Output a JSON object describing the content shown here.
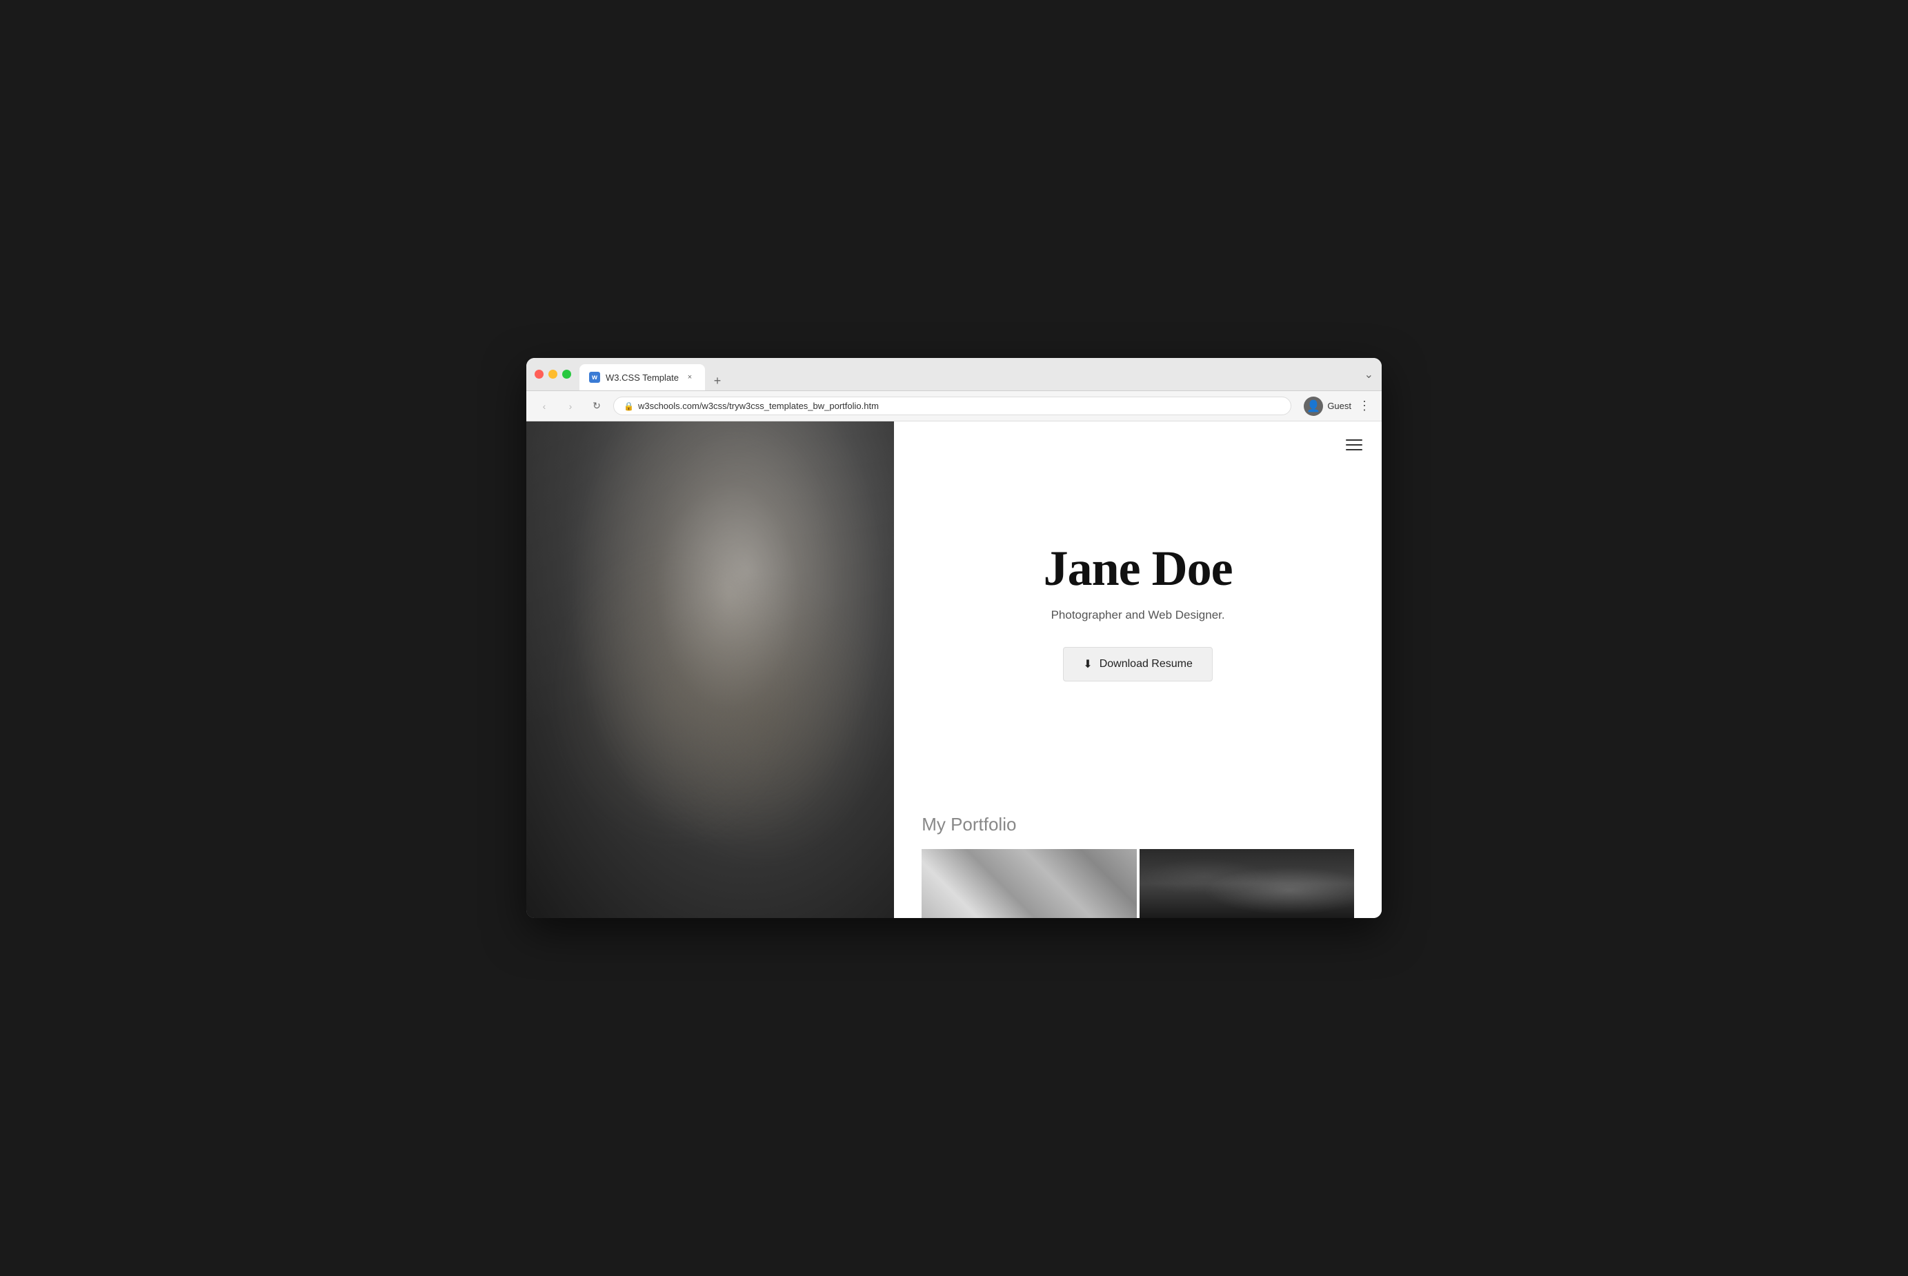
{
  "browser": {
    "tab_favicon": "w",
    "tab_title": "W3.CSS Template",
    "tab_close": "×",
    "tab_new": "+",
    "nav_back": "‹",
    "nav_forward": "›",
    "nav_reload": "↻",
    "address_url": "w3schools.com/w3css/tryw3css_templates_bw_portfolio.htm",
    "profile_icon": "👤",
    "profile_name": "Guest",
    "menu_dots": "⋮",
    "chevron_down": "⌄"
  },
  "page": {
    "hamburger_label": "menu",
    "hero": {
      "name": "Jane Doe",
      "subtitle": "Photographer and Web Designer.",
      "download_btn_label": "Download Resume",
      "download_icon": "⬇"
    },
    "portfolio": {
      "section_title": "My Portfolio"
    }
  }
}
